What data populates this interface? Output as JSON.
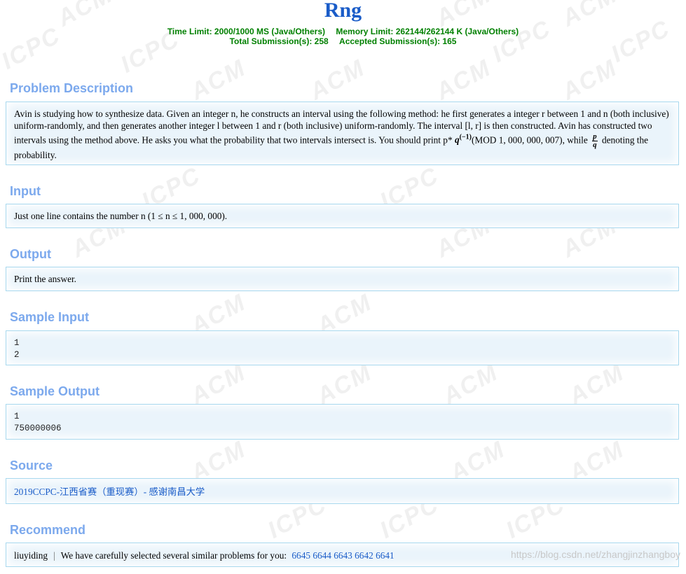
{
  "problem": {
    "title": "Rng",
    "limits_line1_a": "Time Limit: 2000/1000 MS (Java/Others)",
    "limits_line1_b": "Memory Limit: 262144/262144 K (Java/Others)",
    "limits_line2_a": "Total Submission(s): 258",
    "limits_line2_b": "Accepted Submission(s): 165"
  },
  "sections": {
    "description": {
      "heading": "Problem Description",
      "text_part1": "Avin is studying how to synthesize data. Given an integer n, he constructs an interval using the following method: he first generates a integer r between 1 and n (both inclusive) uniform-randomly, and then generates another integer l between 1 and r (both inclusive) uniform-randomly. The interval [l, r] is then constructed. Avin has constructed two intervals using the method above. He asks you what the probability that two intervals intersect is. You should print p*",
      "q_symbol": "q",
      "q_exponent": "(−1)",
      "text_part2": "(MOD 1, 000, 000, 007), while",
      "frac_num": "p",
      "frac_den": "q",
      "text_part3": "denoting the probability."
    },
    "input": {
      "heading": "Input",
      "text": "Just one line contains the number n (1 ≤ n ≤ 1, 000, 000)."
    },
    "output": {
      "heading": "Output",
      "text": "Print the answer."
    },
    "sample_input": {
      "heading": "Sample Input",
      "line1": "1",
      "line2": "2"
    },
    "sample_output": {
      "heading": "Sample Output",
      "line1": "1",
      "line2": "750000006"
    },
    "source": {
      "heading": "Source",
      "text": "2019CCPC-江西省赛（重现赛）- 感谢南昌大学"
    },
    "recommend": {
      "heading": "Recommend",
      "user": "liuyiding",
      "separator": "|",
      "note": "We have carefully selected several similar problems for you:",
      "problems": [
        "6645",
        "6644",
        "6643",
        "6642",
        "6641"
      ]
    }
  },
  "watermark_text": [
    "ACM",
    "ICPC"
  ],
  "url_watermark": "https://blog.csdn.net/zhangjinzhangboy"
}
